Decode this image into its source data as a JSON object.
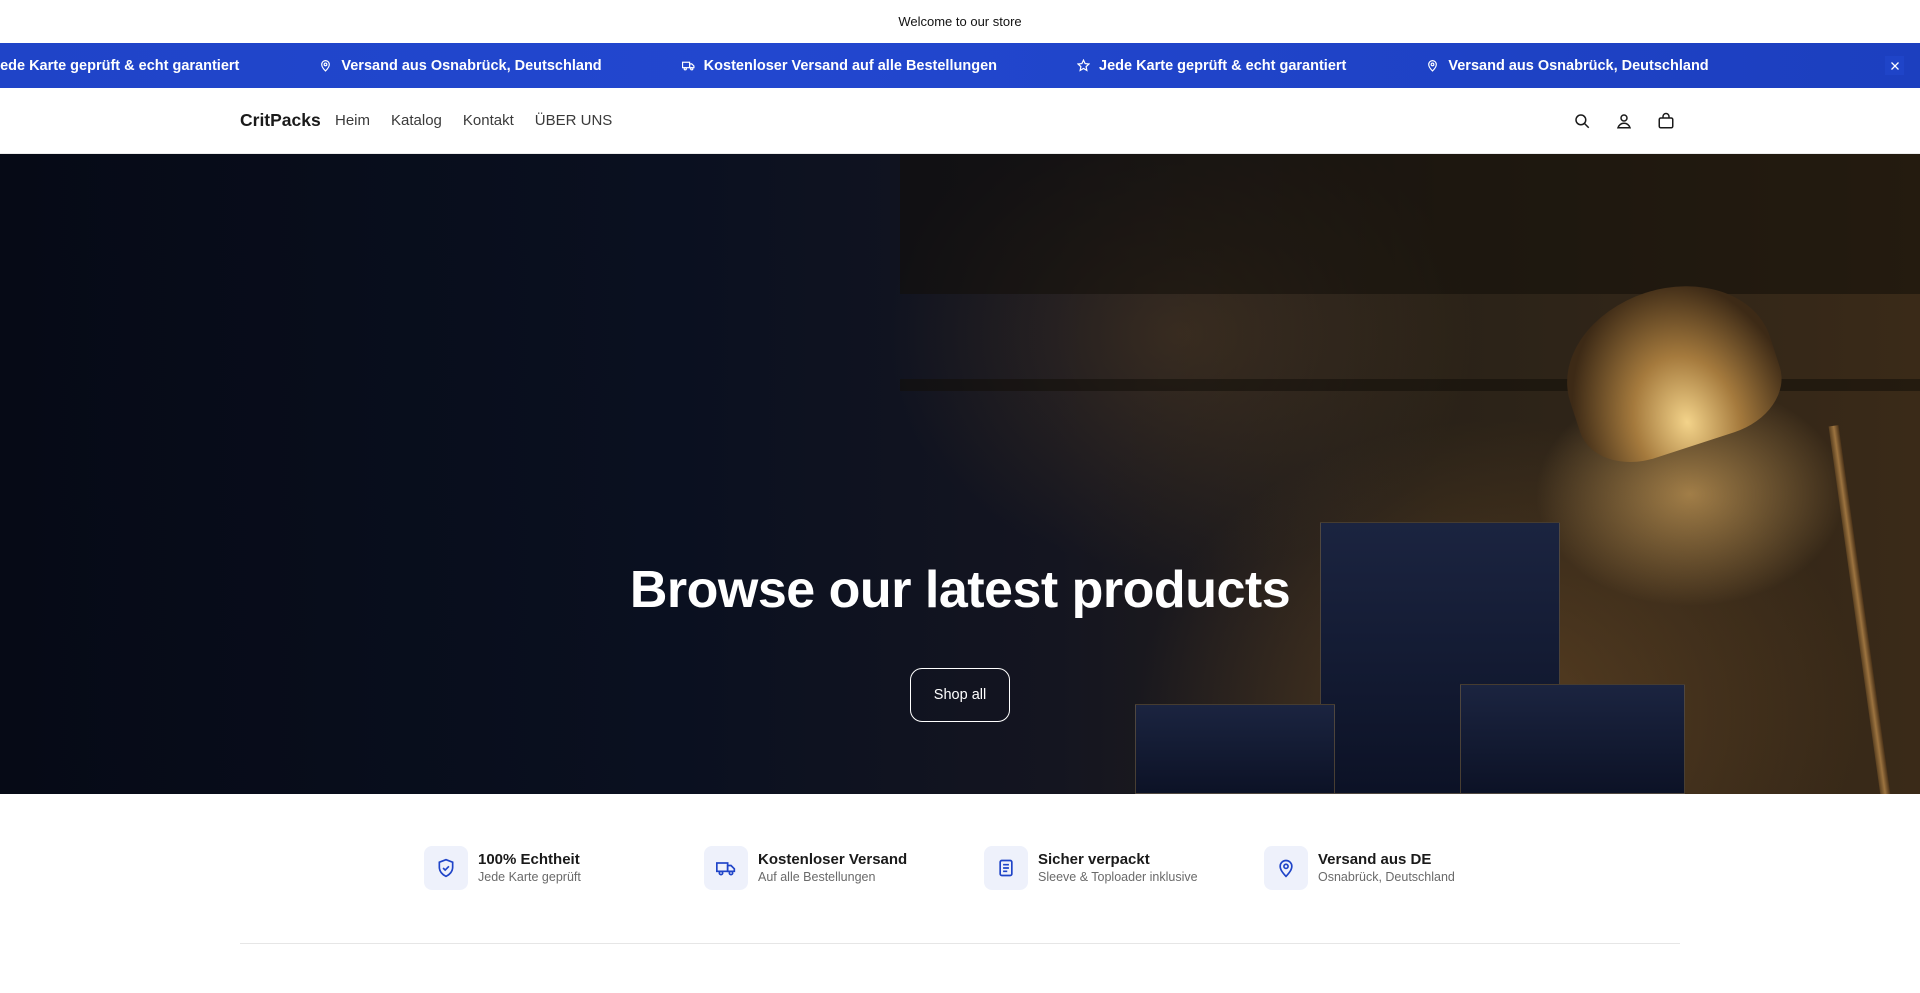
{
  "announcement": {
    "text": "Welcome to our store"
  },
  "marquee": {
    "items": [
      {
        "icon": "star-icon",
        "text": "Jede Karte geprüft & echt garantiert"
      },
      {
        "icon": "map-pin-icon",
        "text": "Versand aus Osnabrück, Deutschland"
      },
      {
        "icon": "truck-icon",
        "text": "Kostenloser Versand auf alle Bestellungen"
      },
      {
        "icon": "star-icon",
        "text": "Jede Karte geprüft & echt garantiert"
      },
      {
        "icon": "map-pin-icon",
        "text": "Versand aus Osnabrück, Deutschland"
      }
    ],
    "close_icon": "close-icon",
    "background_color": "#1f44c8"
  },
  "header": {
    "logo": "CritPacks",
    "nav": [
      "Heim",
      "Katalog",
      "Kontakt",
      "ÜBER UNS"
    ],
    "icons": [
      "search-icon",
      "account-icon",
      "cart-icon"
    ]
  },
  "hero": {
    "title": "Browse our latest products",
    "button": "Shop all"
  },
  "features": [
    {
      "icon": "shield-check-icon",
      "title": "100% Echtheit",
      "subtitle": "Jede Karte geprüft"
    },
    {
      "icon": "truck-icon",
      "title": "Kostenloser Versand",
      "subtitle": "Auf alle Bestellungen"
    },
    {
      "icon": "document-icon",
      "title": "Sicher verpackt",
      "subtitle": "Sleeve & Toploader inklusive"
    },
    {
      "icon": "map-pin-icon",
      "title": "Versand aus DE",
      "subtitle": "Osnabrück, Deutschland"
    }
  ],
  "colors": {
    "accent": "#1f44c8",
    "feature_icon_bg": "#eef1fb"
  }
}
